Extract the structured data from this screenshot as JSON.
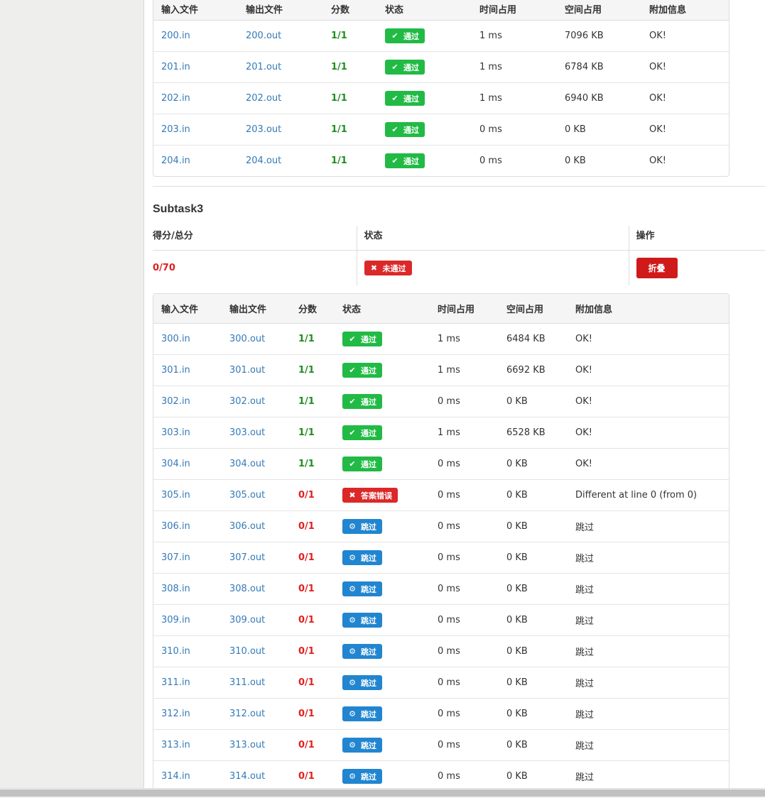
{
  "columns": [
    "输入文件",
    "输出文件",
    "分数",
    "状态",
    "时间占用",
    "空间占用",
    "附加信息"
  ],
  "table1": {
    "rows": [
      {
        "in": "200.in",
        "out": "200.out",
        "score": "1/1",
        "ok": true,
        "status": "pass",
        "time": "1 ms",
        "mem": "7096 KB",
        "info": "OK!"
      },
      {
        "in": "201.in",
        "out": "201.out",
        "score": "1/1",
        "ok": true,
        "status": "pass",
        "time": "1 ms",
        "mem": "6784 KB",
        "info": "OK!"
      },
      {
        "in": "202.in",
        "out": "202.out",
        "score": "1/1",
        "ok": true,
        "status": "pass",
        "time": "1 ms",
        "mem": "6940 KB",
        "info": "OK!"
      },
      {
        "in": "203.in",
        "out": "203.out",
        "score": "1/1",
        "ok": true,
        "status": "pass",
        "time": "0 ms",
        "mem": "0 KB",
        "info": "OK!"
      },
      {
        "in": "204.in",
        "out": "204.out",
        "score": "1/1",
        "ok": true,
        "status": "pass",
        "time": "0 ms",
        "mem": "0 KB",
        "info": "OK!"
      }
    ]
  },
  "subtask": {
    "title": "Subtask3",
    "headers": {
      "score": "得分/总分",
      "status": "状态",
      "action": "操作"
    },
    "score": "0/70",
    "status_label": "未通过",
    "fold_label": "折叠"
  },
  "status_labels": {
    "pass": "通过",
    "wrong": "答案错误",
    "skip": "跳过"
  },
  "colors": {
    "pass": "#21ba45",
    "fail": "#db2828",
    "skip": "#2185d0",
    "link": "#337ab7",
    "score_ok": "#1e8e1e",
    "score_bad": "#e02020"
  },
  "icons": {
    "pass": "check-icon",
    "fail": "x-icon",
    "skip": "gear-icon"
  },
  "table2": {
    "rows": [
      {
        "in": "300.in",
        "out": "300.out",
        "score": "1/1",
        "ok": true,
        "status": "pass",
        "time": "1 ms",
        "mem": "6484 KB",
        "info": "OK!"
      },
      {
        "in": "301.in",
        "out": "301.out",
        "score": "1/1",
        "ok": true,
        "status": "pass",
        "time": "1 ms",
        "mem": "6692 KB",
        "info": "OK!"
      },
      {
        "in": "302.in",
        "out": "302.out",
        "score": "1/1",
        "ok": true,
        "status": "pass",
        "time": "0 ms",
        "mem": "0 KB",
        "info": "OK!"
      },
      {
        "in": "303.in",
        "out": "303.out",
        "score": "1/1",
        "ok": true,
        "status": "pass",
        "time": "1 ms",
        "mem": "6528 KB",
        "info": "OK!"
      },
      {
        "in": "304.in",
        "out": "304.out",
        "score": "1/1",
        "ok": true,
        "status": "pass",
        "time": "0 ms",
        "mem": "0 KB",
        "info": "OK!"
      },
      {
        "in": "305.in",
        "out": "305.out",
        "score": "0/1",
        "ok": false,
        "status": "wrong",
        "time": "0 ms",
        "mem": "0 KB",
        "info": "Different at line 0 (from 0)"
      },
      {
        "in": "306.in",
        "out": "306.out",
        "score": "0/1",
        "ok": false,
        "status": "skip",
        "time": "0 ms",
        "mem": "0 KB",
        "info": "跳过"
      },
      {
        "in": "307.in",
        "out": "307.out",
        "score": "0/1",
        "ok": false,
        "status": "skip",
        "time": "0 ms",
        "mem": "0 KB",
        "info": "跳过"
      },
      {
        "in": "308.in",
        "out": "308.out",
        "score": "0/1",
        "ok": false,
        "status": "skip",
        "time": "0 ms",
        "mem": "0 KB",
        "info": "跳过"
      },
      {
        "in": "309.in",
        "out": "309.out",
        "score": "0/1",
        "ok": false,
        "status": "skip",
        "time": "0 ms",
        "mem": "0 KB",
        "info": "跳过"
      },
      {
        "in": "310.in",
        "out": "310.out",
        "score": "0/1",
        "ok": false,
        "status": "skip",
        "time": "0 ms",
        "mem": "0 KB",
        "info": "跳过"
      },
      {
        "in": "311.in",
        "out": "311.out",
        "score": "0/1",
        "ok": false,
        "status": "skip",
        "time": "0 ms",
        "mem": "0 KB",
        "info": "跳过"
      },
      {
        "in": "312.in",
        "out": "312.out",
        "score": "0/1",
        "ok": false,
        "status": "skip",
        "time": "0 ms",
        "mem": "0 KB",
        "info": "跳过"
      },
      {
        "in": "313.in",
        "out": "313.out",
        "score": "0/1",
        "ok": false,
        "status": "skip",
        "time": "0 ms",
        "mem": "0 KB",
        "info": "跳过"
      },
      {
        "in": "314.in",
        "out": "314.out",
        "score": "0/1",
        "ok": false,
        "status": "skip",
        "time": "0 ms",
        "mem": "0 KB",
        "info": "跳过"
      }
    ]
  }
}
